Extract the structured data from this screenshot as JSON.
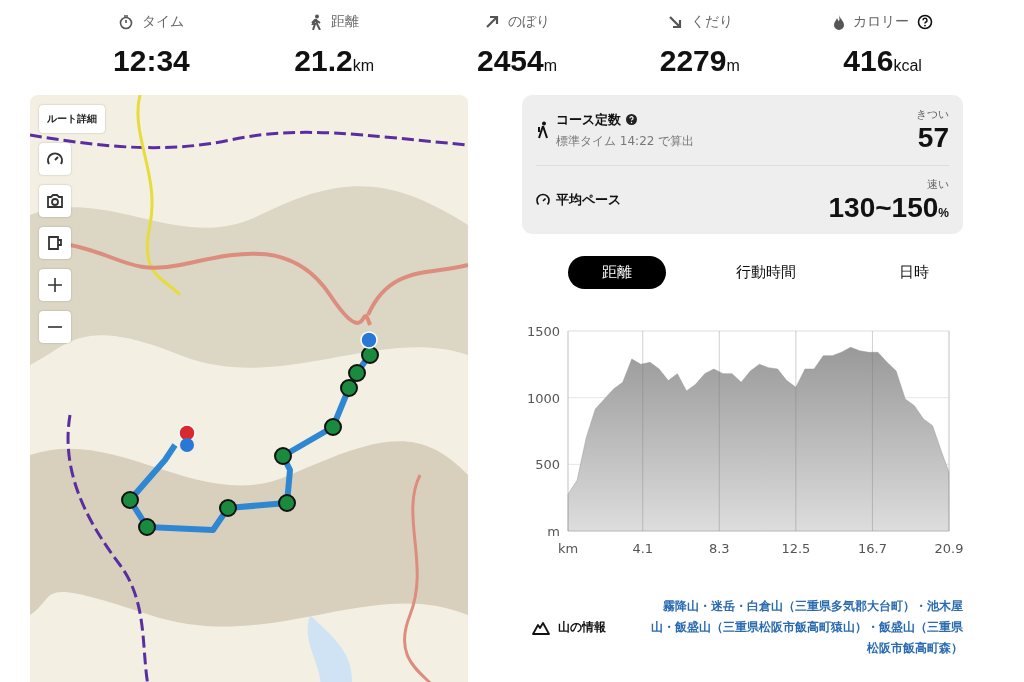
{
  "stats": [
    {
      "label": "タイム",
      "value": "12:34",
      "has_help": false
    },
    {
      "label": "距離",
      "value": "21.2",
      "unit": "km",
      "has_help": false
    },
    {
      "label": "のぼり",
      "value": "2454",
      "unit": "m",
      "has_help": false
    },
    {
      "label": "くだり",
      "value": "2279",
      "unit": "m",
      "has_help": false
    },
    {
      "label": "カロリー",
      "value": "416",
      "unit": "kcal",
      "has_help": true
    }
  ],
  "map": {
    "kind": "picture",
    "route_details_button": "ルート詳細"
  },
  "course_card": {
    "course": {
      "title": "コース定数",
      "subtitle": "標準タイム 14:22 で算出",
      "rating": "きつい",
      "value": "57"
    },
    "pace": {
      "title": "平均ペース",
      "rating": "速い",
      "value": "130~150",
      "unit": "%"
    }
  },
  "tabs": [
    {
      "label": "距離",
      "selected": true
    },
    {
      "label": "行動時間",
      "selected": false
    },
    {
      "label": "日時",
      "selected": false
    }
  ],
  "elevation": {
    "chart_data": {
      "type": "area",
      "x": [
        0,
        0.5,
        1,
        1.5,
        2,
        2.5,
        3,
        3.5,
        4,
        4.5,
        5,
        5.5,
        6,
        6.5,
        7,
        7.5,
        8,
        8.5,
        9,
        9.5,
        10,
        10.5,
        11,
        11.5,
        12,
        12.5,
        13,
        13.5,
        14,
        14.5,
        15,
        15.5,
        16,
        16.5,
        17,
        17.5,
        18,
        18.5,
        19,
        19.5,
        20,
        20.5,
        20.9
      ],
      "grid": true,
      "series": [
        {
          "color": "#9a9a9a",
          "values": [
            275,
            380,
            700,
            915,
            990,
            1065,
            1115,
            1290,
            1250,
            1265,
            1215,
            1128,
            1180,
            1050,
            1100,
            1180,
            1215,
            1180,
            1180,
            1115,
            1200,
            1250,
            1225,
            1215,
            1128,
            1078,
            1215,
            1215,
            1315,
            1315,
            1340,
            1378,
            1352,
            1340,
            1340,
            1265,
            1200,
            990,
            940,
            840,
            790,
            590,
            440
          ]
        }
      ],
      "xlim": [
        0,
        20.9
      ],
      "ylim": [
        0,
        1500
      ],
      "xticks": [
        {
          "value": 0,
          "label": "km"
        },
        4.1,
        8.3,
        12.5,
        16.7,
        20.9
      ],
      "yticks": [
        {
          "value": 0,
          "label": "m"
        },
        500,
        1000,
        1500
      ]
    }
  },
  "mountain_info": {
    "label": "山の情報",
    "mountains": "霧降山・迷岳・白倉山（三重県多気郡大台町）・池木屋山・飯盛山（三重県松阪市飯高町猿山）・飯盛山（三重県松阪市飯高町森）"
  }
}
